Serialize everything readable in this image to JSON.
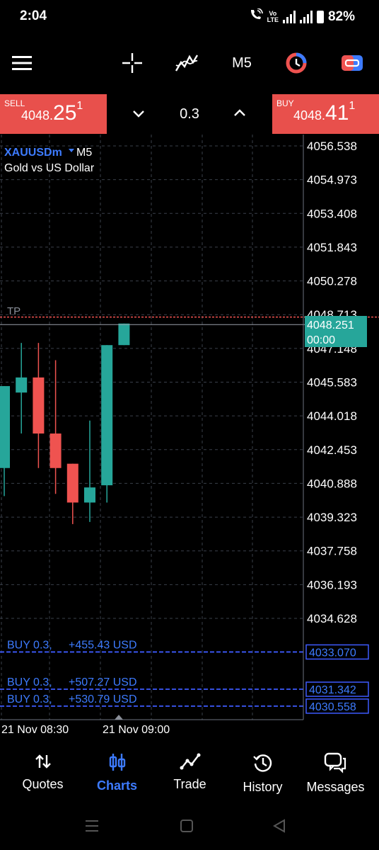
{
  "status_bar": {
    "time": "2:04",
    "volte_top": "Vo",
    "volte_bottom": "LTE",
    "battery": "82%"
  },
  "toolbar": {
    "menu_icon": "hamburger-menu-icon",
    "crosshair_icon": "crosshair-icon",
    "indicators_icon": "indicators-icon",
    "timeframe": "M5",
    "objects_icon": "chart-objects-icon",
    "trade_icon": "one-click-trading-icon"
  },
  "trade_panel": {
    "sell_label": "SELL",
    "sell_price_small": "4048.",
    "sell_price_big": "25",
    "sell_price_sup": "1",
    "buy_label": "BUY",
    "buy_price_small": "4048.",
    "buy_price_big": "41",
    "buy_price_sup": "1",
    "lot": "0.3"
  },
  "chart": {
    "symbol": "XAUUSDm",
    "timeframe": "M5",
    "description": "Gold vs US Dollar",
    "tp_label": "TP",
    "current_price_tag": "4048.251",
    "countdown": "00:00",
    "colors": {
      "bull": "#26a69a",
      "bear": "#ef5350",
      "grid": "#3a3f4a",
      "order_line": "#3d5afe",
      "tp_line": "#ef5350"
    }
  },
  "chart_data": {
    "type": "candlestick",
    "price_axis": [
      "4056.538",
      "4054.973",
      "4053.408",
      "4051.843",
      "4050.278",
      "4048.713",
      "4047.148",
      "4045.583",
      "4044.018",
      "4042.453",
      "4040.888",
      "4039.323",
      "4037.758",
      "4036.193",
      "4034.628"
    ],
    "time_axis": [
      "21 Nov 08:30",
      "21 Nov 09:00"
    ],
    "ylim": [
      4030.2,
      4057.0
    ],
    "candles": [
      {
        "o": 4041.6,
        "h": 4045.4,
        "l": 4040.3,
        "c": 4045.4
      },
      {
        "o": 4045.1,
        "h": 4047.4,
        "l": 4043.2,
        "c": 4045.8
      },
      {
        "o": 4045.8,
        "h": 4047.4,
        "l": 4041.6,
        "c": 4043.2
      },
      {
        "o": 4043.2,
        "h": 4046.6,
        "l": 4040.4,
        "c": 4041.6
      },
      {
        "o": 4041.8,
        "h": 4041.8,
        "l": 4039.0,
        "c": 4040.0
      },
      {
        "o": 4040.0,
        "h": 4043.8,
        "l": 4039.1,
        "c": 4040.7
      },
      {
        "o": 4040.8,
        "h": 4047.3,
        "l": 4040.0,
        "c": 4047.3
      },
      {
        "o": 4047.3,
        "h": 4048.3,
        "l": 4047.3,
        "c": 4048.3
      }
    ],
    "tp_price": 4048.6,
    "current_price": 4048.251,
    "orders": [
      {
        "label": "BUY 0.3,",
        "profit": "+455.43 USD",
        "price": "4033.070",
        "value": 4033.07
      },
      {
        "label": "BUY 0.3,",
        "profit": "+507.27 USD",
        "price": "4031.342",
        "value": 4031.342
      },
      {
        "label": "BUY 0.3,",
        "profit": "+530.79 USD",
        "price": "4030.558",
        "value": 4030.558
      }
    ]
  },
  "bottom_nav": {
    "items": [
      {
        "label": "Quotes",
        "icon": "quotes-icon"
      },
      {
        "label": "Charts",
        "icon": "charts-icon",
        "active": true
      },
      {
        "label": "Trade",
        "icon": "trade-icon"
      },
      {
        "label": "History",
        "icon": "history-icon"
      },
      {
        "label": "Messages",
        "icon": "messages-icon"
      }
    ]
  }
}
